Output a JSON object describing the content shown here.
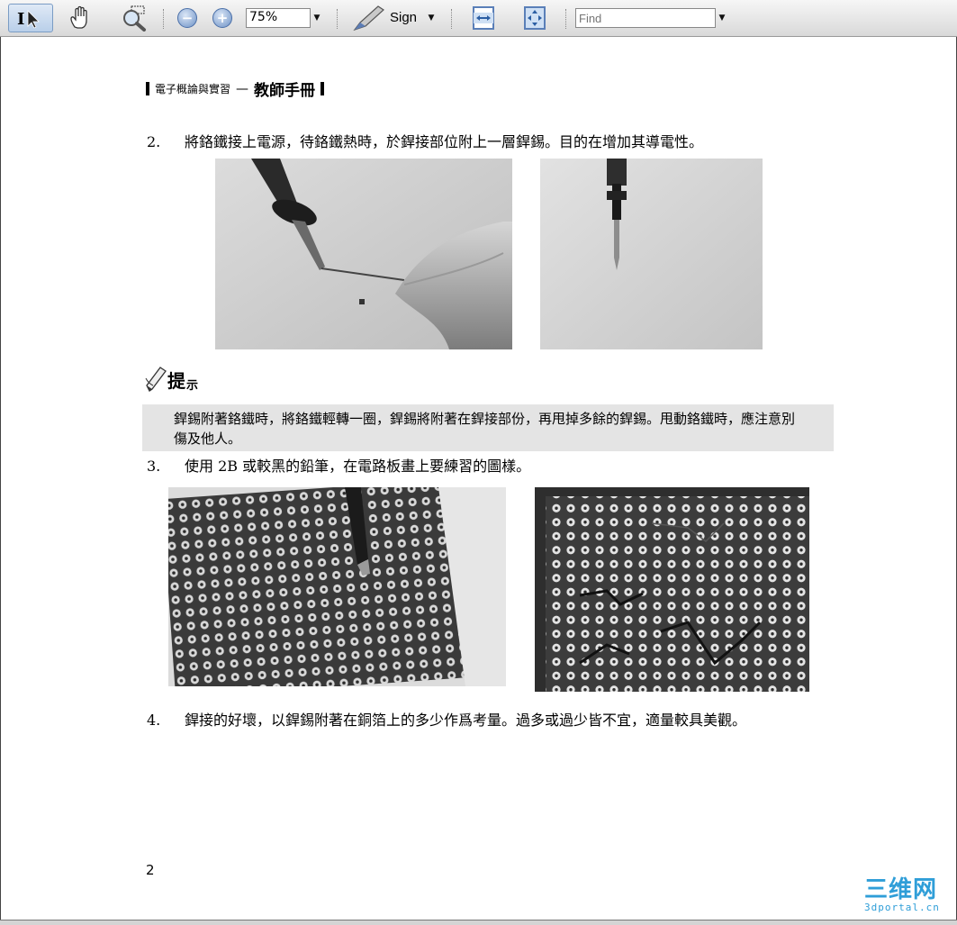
{
  "toolbar": {
    "zoom_value": "75%",
    "sign_label": "Sign",
    "find_placeholder": "Find",
    "icons": [
      "text-select-icon",
      "hand-tool-icon",
      "marquee-zoom-icon",
      "zoom-out-icon",
      "zoom-in-icon",
      "sign-pen-icon",
      "fit-width-icon",
      "fit-page-icon"
    ]
  },
  "document": {
    "header": {
      "title": "電子概論與實習",
      "dash": "—",
      "role": "教師手冊"
    },
    "steps": [
      {
        "num": "2.",
        "text": "將鉻鐵接上電源，待鉻鐵熱時，於銲接部位附上一層銲錫。目的在增加其導電性。"
      },
      {
        "num": "3.",
        "text": "使用 2B 或較黑的鉛筆，在電路板畫上要練習的圖樣。"
      },
      {
        "num": "4.",
        "text": "銲接的好壞，以銲錫附著在銅箔上的多少作爲考量。過多或過少皆不宜，適量較具美觀。"
      }
    ],
    "tip": {
      "title": "提",
      "subtitle": "示",
      "text": "銲錫附著鉻鐵時，將鉻鐵輕轉一圈，銲錫將附著在銲接部份，再甩掉多餘的銲錫。甩動鉻鐵時，應注意別傷及他人。"
    },
    "page_number": "2"
  },
  "watermark": {
    "main": "三维网",
    "sub": "3dportal.cn"
  }
}
